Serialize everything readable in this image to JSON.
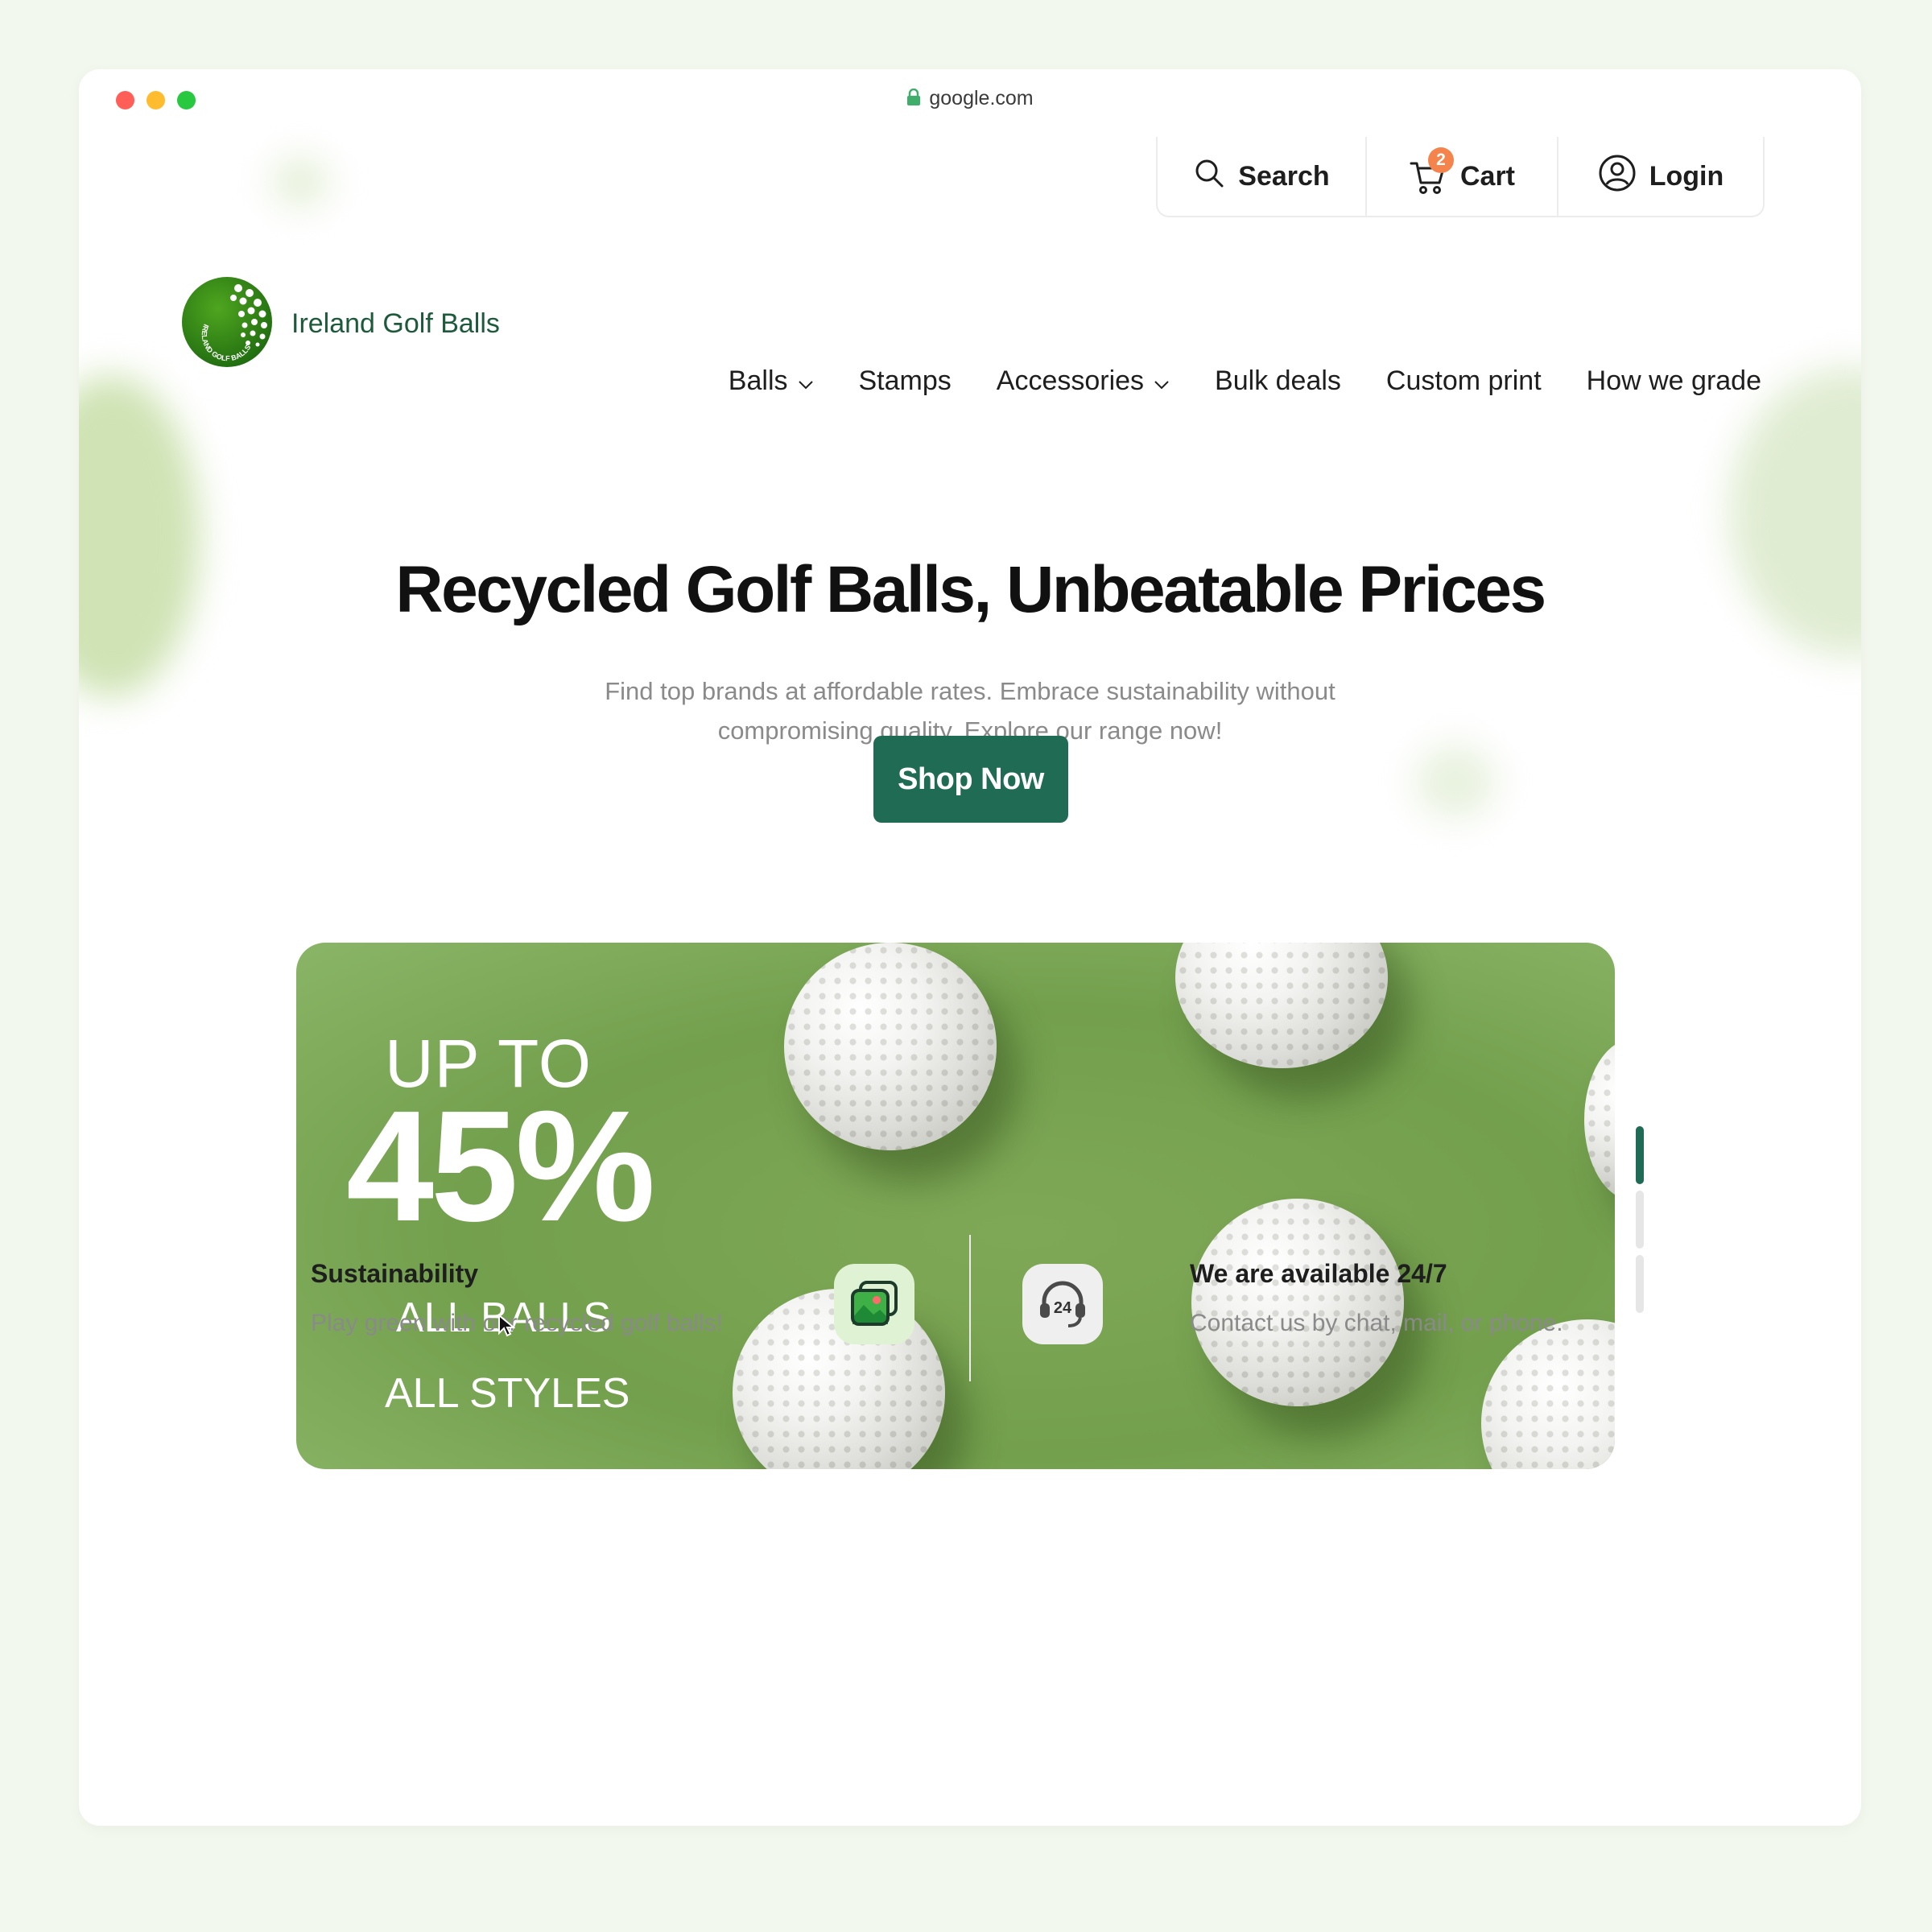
{
  "browser": {
    "url": "google.com"
  },
  "topbar": {
    "search_label": "Search",
    "cart_label": "Cart",
    "cart_count": "2",
    "login_label": "Login"
  },
  "brand": {
    "name": "Ireland Golf Balls",
    "logo_ring_text": "IRELAND GOLF BALLS"
  },
  "nav": {
    "items": [
      {
        "label": "Balls",
        "has_dropdown": true
      },
      {
        "label": "Stamps",
        "has_dropdown": false
      },
      {
        "label": "Accessories",
        "has_dropdown": true
      },
      {
        "label": "Bulk deals",
        "has_dropdown": false
      },
      {
        "label": "Custom print",
        "has_dropdown": false
      },
      {
        "label": "How we grade",
        "has_dropdown": false
      }
    ]
  },
  "hero": {
    "title": "Recycled Golf Balls, Unbeatable Prices",
    "subtitle_line1": "Find top brands at affordable rates. Embrace sustainability without",
    "subtitle_line2": "compromising quality. Explore our range now!",
    "cta_label": "Shop Now"
  },
  "banner": {
    "line1": "UP TO",
    "percent": "45%",
    "line3": "ALL BALLS",
    "line4": "ALL STYLES",
    "slides_total": 3,
    "active_slide": 1
  },
  "features": [
    {
      "title": "Sustainability",
      "subtitle": "Play green with our recycled golf balls!",
      "icon": "image-gallery-icon"
    },
    {
      "title": "We are available 24/7",
      "subtitle": "Contact us by chat, mail, or phone.",
      "icon": "headset-24-icon",
      "icon_text": "24"
    }
  ],
  "colors": {
    "brand_green": "#206b54",
    "brand_text": "#1d5a3c",
    "cart_badge": "#f5844c",
    "banner_bg": "#7aa552",
    "page_bg": "#f3f8ee"
  }
}
